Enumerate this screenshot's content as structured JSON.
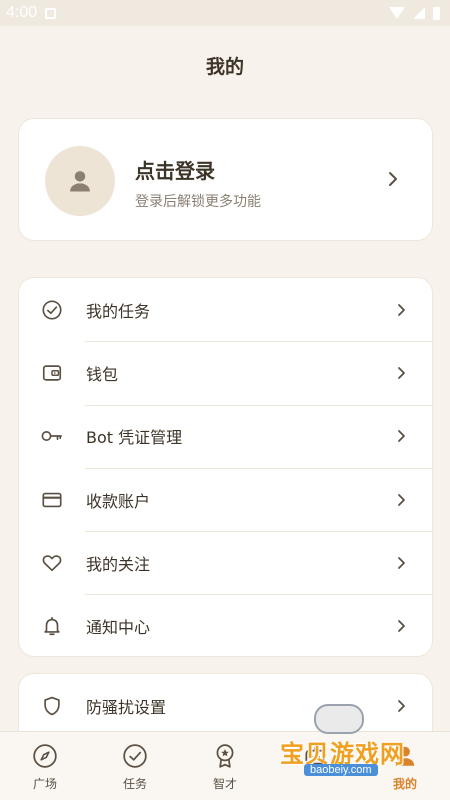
{
  "status_bar": {
    "time": "4:00"
  },
  "header": {
    "title": "我的"
  },
  "profile": {
    "name": "点击登录",
    "subtitle": "登录后解锁更多功能"
  },
  "menu": {
    "items": [
      {
        "label": "我的任务",
        "icon": "check-circle-icon"
      },
      {
        "label": "钱包",
        "icon": "wallet-icon"
      },
      {
        "label": "Bot 凭证管理",
        "icon": "key-icon"
      },
      {
        "label": "收款账户",
        "icon": "credit-card-icon"
      },
      {
        "label": "我的关注",
        "icon": "heart-icon"
      },
      {
        "label": "通知中心",
        "icon": "bell-icon"
      }
    ]
  },
  "menu2": {
    "items": [
      {
        "label": "防骚扰设置",
        "icon": "shield-icon"
      }
    ]
  },
  "tabs": [
    {
      "label": "广场",
      "icon": "compass-icon"
    },
    {
      "label": "任务",
      "icon": "check-circle-icon"
    },
    {
      "label": "智才",
      "icon": "award-icon"
    },
    {
      "label": "",
      "icon": "bot-icon"
    },
    {
      "label": "我的",
      "icon": "user-icon",
      "active": true
    }
  ],
  "watermark": {
    "text": "宝贝游戏网",
    "url": "baobeiy.com"
  },
  "colors": {
    "background": "#f7f3ec",
    "card": "#ffffff",
    "accent": "#d9822b",
    "text": "#3d3428",
    "muted": "#8a8073"
  }
}
